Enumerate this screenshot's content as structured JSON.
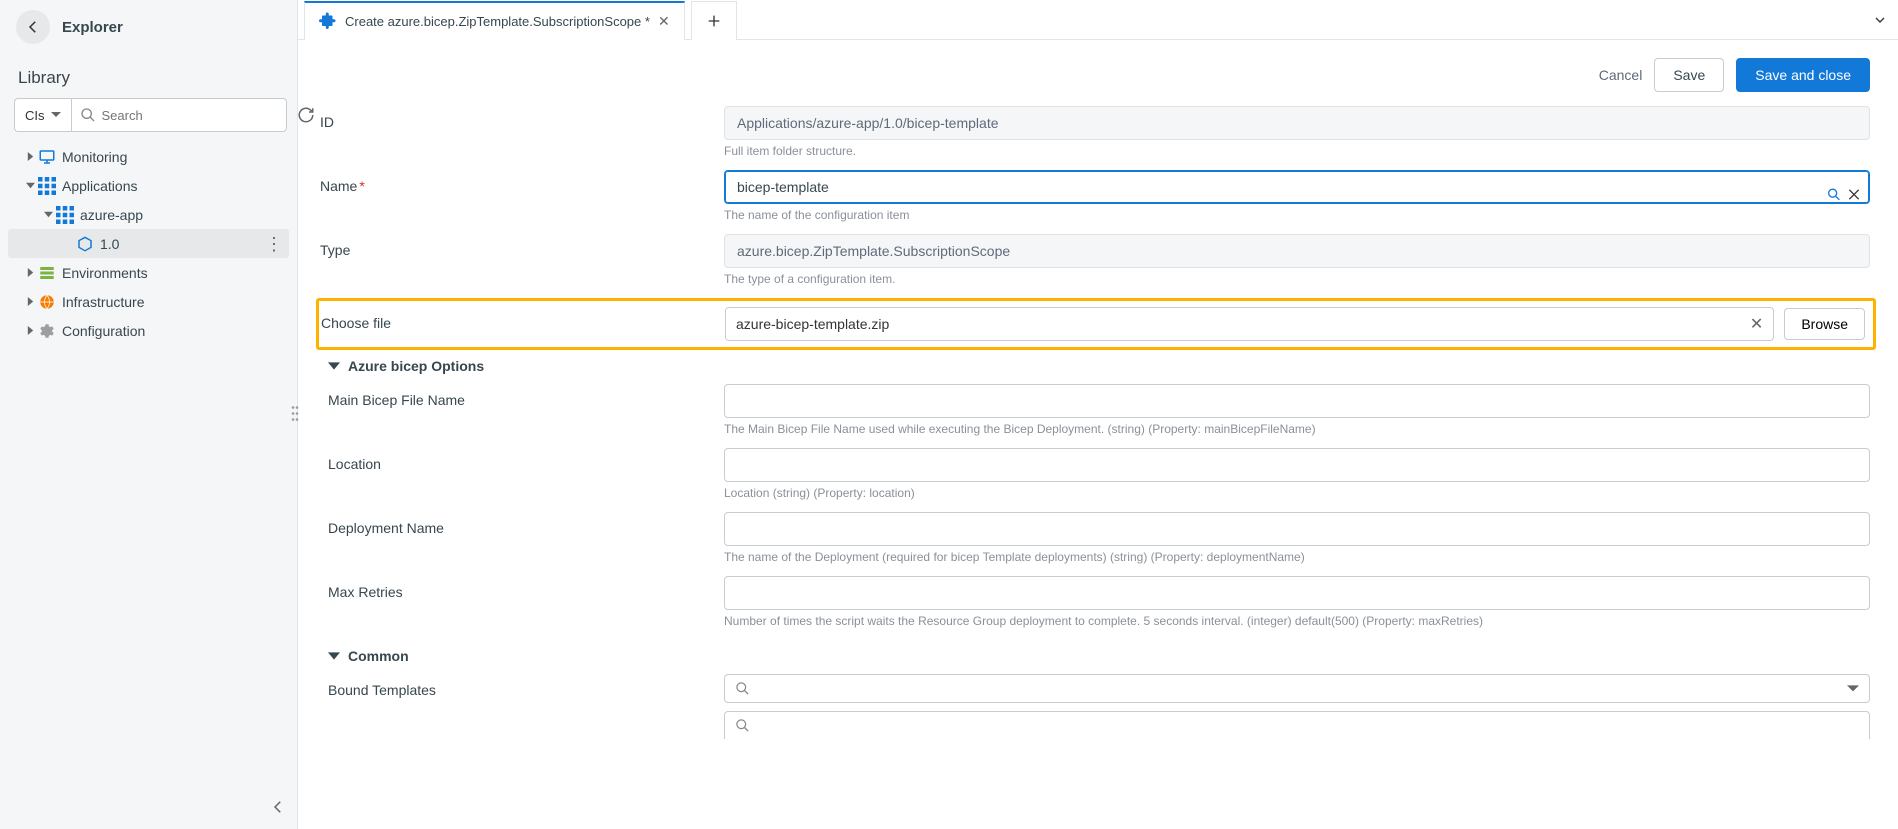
{
  "sidebar": {
    "explorer_title": "Explorer",
    "library_title": "Library",
    "cis_label": "CIs",
    "search_placeholder": "Search",
    "tree": {
      "monitoring": "Monitoring",
      "applications": "Applications",
      "azure_app": "azure-app",
      "version": "1.0",
      "environments": "Environments",
      "infrastructure": "Infrastructure",
      "configuration": "Configuration"
    }
  },
  "tabs": {
    "active": "Create azure.bicep.ZipTemplate.SubscriptionScope *"
  },
  "actions": {
    "cancel": "Cancel",
    "save": "Save",
    "save_and_close": "Save and close"
  },
  "form": {
    "id_label": "ID",
    "id_value": "Applications/azure-app/1.0/bicep-template",
    "id_help": "Full item folder structure.",
    "name_label": "Name",
    "name_value": "bicep-template",
    "name_help": "The name of the configuration item",
    "type_label": "Type",
    "type_value": "azure.bicep.ZipTemplate.SubscriptionScope",
    "type_help": "The type of a configuration item.",
    "choose_file_label": "Choose file",
    "choose_file_value": "azure-bicep-template.zip",
    "browse_label": "Browse",
    "sections": {
      "bicep_options": "Azure bicep Options",
      "common": "Common"
    },
    "bicep": {
      "main_file_label": "Main Bicep File Name",
      "main_file_help": "The Main Bicep File Name used while executing the Bicep Deployment. (string) (Property: mainBicepFileName)",
      "location_label": "Location",
      "location_help": "Location (string) (Property: location)",
      "deploy_label": "Deployment Name",
      "deploy_help": "The name of the Deployment (required for bicep Template deployments) (string) (Property: deploymentName)",
      "retries_label": "Max Retries",
      "retries_help": "Number of times the script waits the Resource Group deployment to complete. 5 seconds interval. (integer) default(500) (Property: maxRetries)"
    },
    "common_fields": {
      "bound_templates_label": "Bound Templates"
    }
  }
}
